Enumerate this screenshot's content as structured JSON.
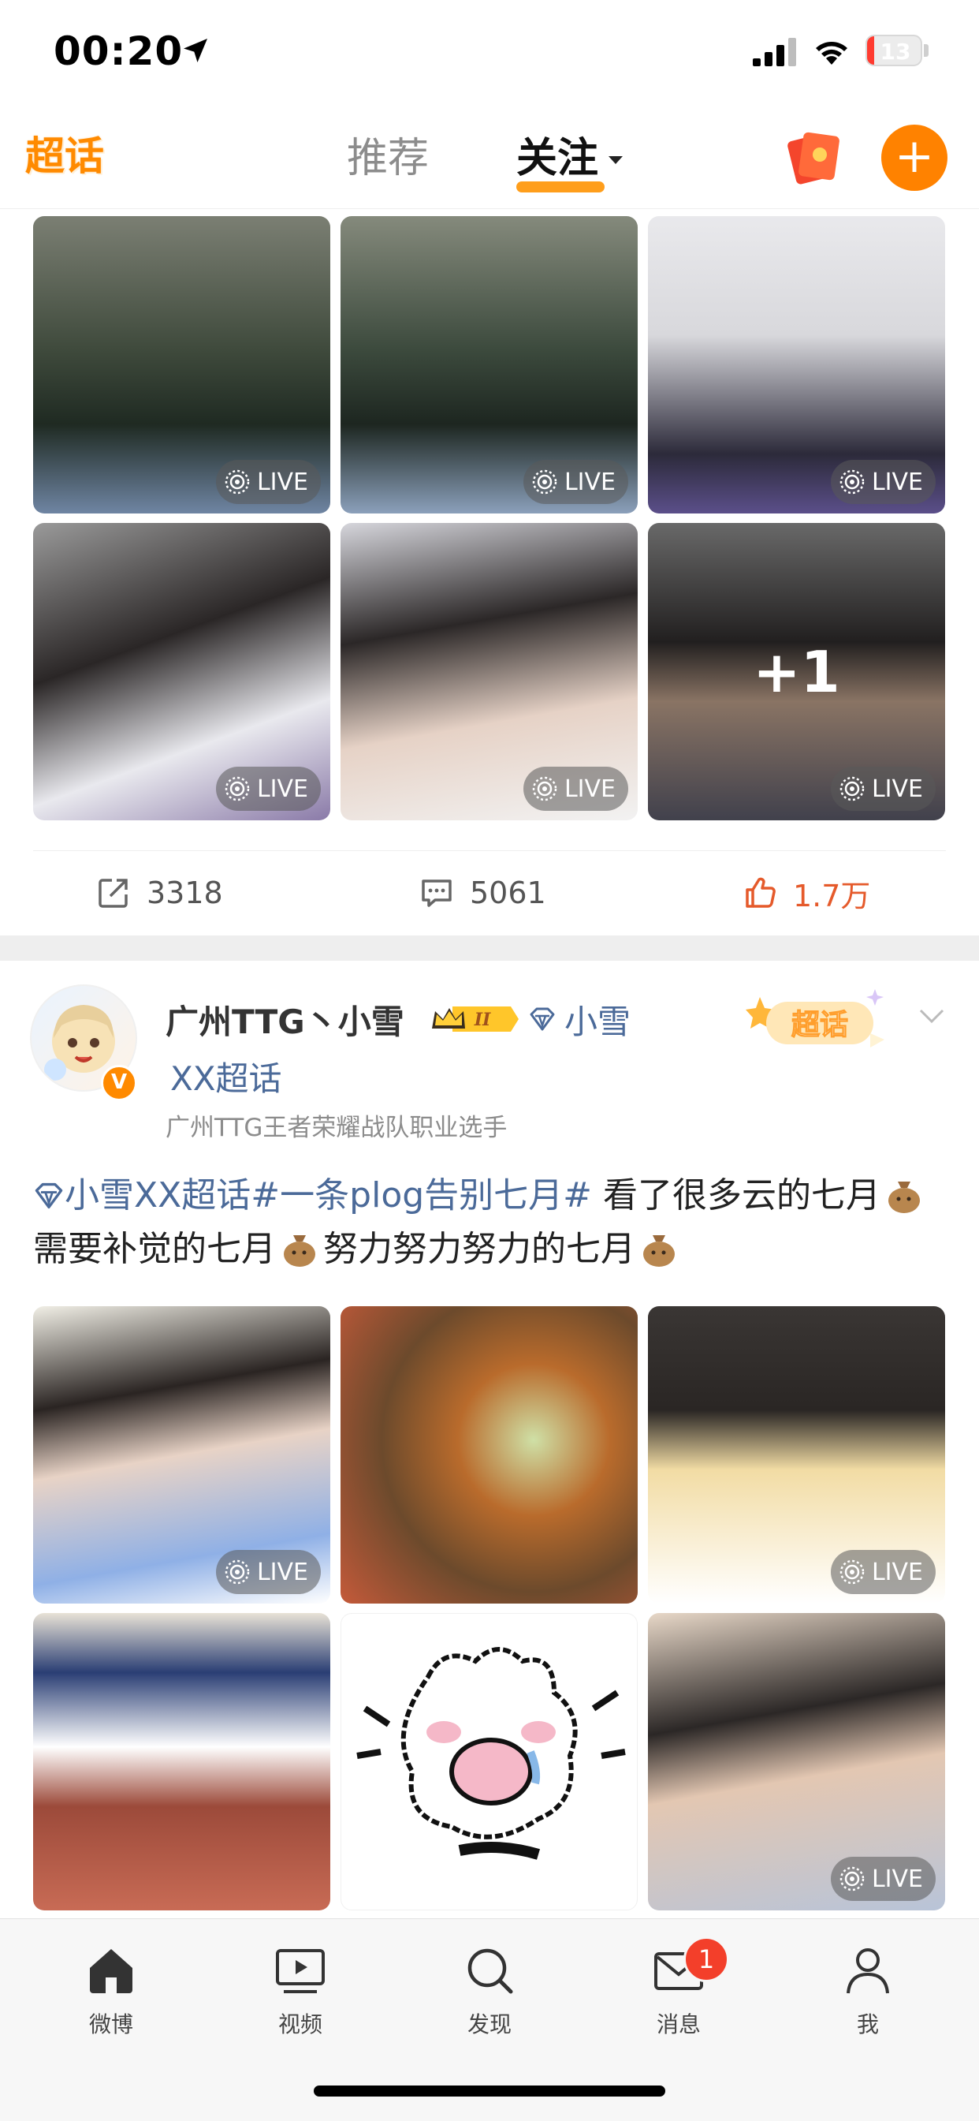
{
  "status_bar": {
    "time": "00:20",
    "battery": "13",
    "battery_level": 0.13,
    "signal_icon": "cellular-signal-icon",
    "wifi_icon": "wifi-icon",
    "location_icon": "location-arrow-icon"
  },
  "header": {
    "brand": "超话",
    "tabs": [
      {
        "label": "推荐",
        "active": false
      },
      {
        "label": "关注",
        "active": true
      }
    ],
    "accent_color": "#ff8200",
    "right_icons": [
      "red-packet-icon",
      "add-icon"
    ]
  },
  "post1": {
    "images": [
      {
        "live_label": "LIVE",
        "desc": "photo"
      },
      {
        "live_label": "LIVE",
        "desc": "photo"
      },
      {
        "live_label": "LIVE",
        "desc": "photo"
      },
      {
        "live_label": "LIVE",
        "desc": "photo"
      },
      {
        "live_label": "LIVE",
        "desc": "photo"
      },
      {
        "live_label": "LIVE",
        "desc": "photo",
        "more": "+1"
      }
    ],
    "share_count": "3318",
    "comment_count": "5061",
    "like_count": "1.7万"
  },
  "post2": {
    "author": "广州TTG丶小雪",
    "level_badge": "II",
    "topic_part1": "小雪",
    "topic_part2": "XX超话",
    "description": "广州TTG王者荣耀战队职业选手",
    "sticker": "超话",
    "verify_mark": "V",
    "text_topic": "小雪XX超话",
    "text_hashtag": "#一条plog告别七月#",
    "text_seg1": " 看了很多云的七月",
    "text_seg2": "需要补觉的七月",
    "text_seg3": "努力努力努力的七月",
    "images": [
      {
        "live_label": "LIVE"
      },
      {
        "live_label": ""
      },
      {
        "live_label": "LIVE"
      },
      {
        "live_label": ""
      },
      {
        "live_label": ""
      },
      {
        "live_label": "LIVE"
      }
    ]
  },
  "tabbar": {
    "items": [
      {
        "label": "微博",
        "icon": "home-icon",
        "active": true
      },
      {
        "label": "视频",
        "icon": "video-icon"
      },
      {
        "label": "发现",
        "icon": "search-icon"
      },
      {
        "label": "消息",
        "icon": "mail-icon",
        "badge": "1"
      },
      {
        "label": "我",
        "icon": "profile-icon"
      }
    ]
  }
}
